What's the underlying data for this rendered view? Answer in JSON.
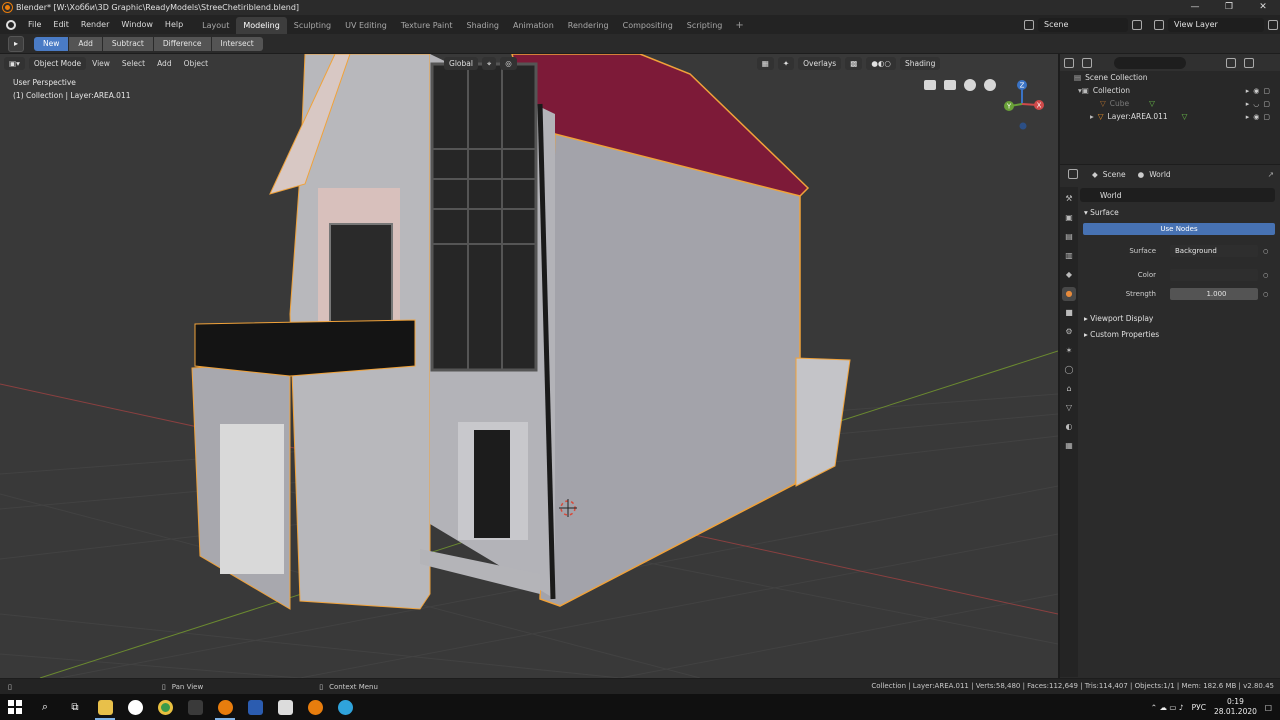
{
  "window": {
    "title": "Blender* [W:\\Хобби\\3D Graphic\\ReadyModels\\StreeChetiriblend.blend]",
    "controls": [
      "—",
      "❐",
      "✕"
    ]
  },
  "menubar": {
    "items": [
      "File",
      "Edit",
      "Render",
      "Window",
      "Help"
    ],
    "workspaces": [
      "Layout",
      "Modeling",
      "Sculpting",
      "UV Editing",
      "Texture Paint",
      "Shading",
      "Animation",
      "Rendering",
      "Compositing",
      "Scripting"
    ],
    "active_workspace": "Modeling",
    "add_tab": "+",
    "scene": "Scene",
    "view_layer": "View Layer"
  },
  "tool_header": {
    "boolean_ops": [
      "New",
      "Add",
      "Subtract",
      "Difference",
      "Intersect"
    ]
  },
  "viewport": {
    "mode": "Object Mode",
    "menus": [
      "View",
      "Select",
      "Add",
      "Object"
    ],
    "orientation": "Global",
    "overlays_label": "Overlays",
    "shading_label": "Shading",
    "perspective_text": "User Perspective",
    "collection_text": "(1) Collection | Layer:AREA.011",
    "gizmo_axes": [
      "Z",
      "Y",
      "X"
    ]
  },
  "outliner": {
    "root": "Scene Collection",
    "items": [
      {
        "label": "Collection",
        "indent": 1
      },
      {
        "label": "Cube",
        "indent": 2
      },
      {
        "label": "Layer:AREA.011",
        "indent": 2
      }
    ]
  },
  "properties": {
    "breadcrumb": [
      "Scene",
      "World"
    ],
    "world_name": "World",
    "surface_panel": "Surface",
    "use_nodes_label": "Use Nodes",
    "surface_label": "Surface",
    "surface_value": "Background",
    "color_label": "Color",
    "strength_label": "Strength",
    "strength_value": "1.000",
    "viewport_display": "Viewport Display",
    "custom_properties": "Custom Properties"
  },
  "statusbar": {
    "left_hint": "Pan View",
    "mid_hint": "Context Menu",
    "stats": "Collection | Layer:AREA.011 | Verts:58,480 | Faces:112,649 | Tris:114,407 | Objects:1/1 | Mem: 182.6 MB | v2.80.45"
  },
  "taskbar": {
    "lang": "РУС",
    "time": "0:19",
    "date": "28.01.2020"
  },
  "colors": {
    "accent_blue": "#4772b3",
    "selection_orange": "#f0a23a",
    "roof": "#8a1a3a"
  }
}
